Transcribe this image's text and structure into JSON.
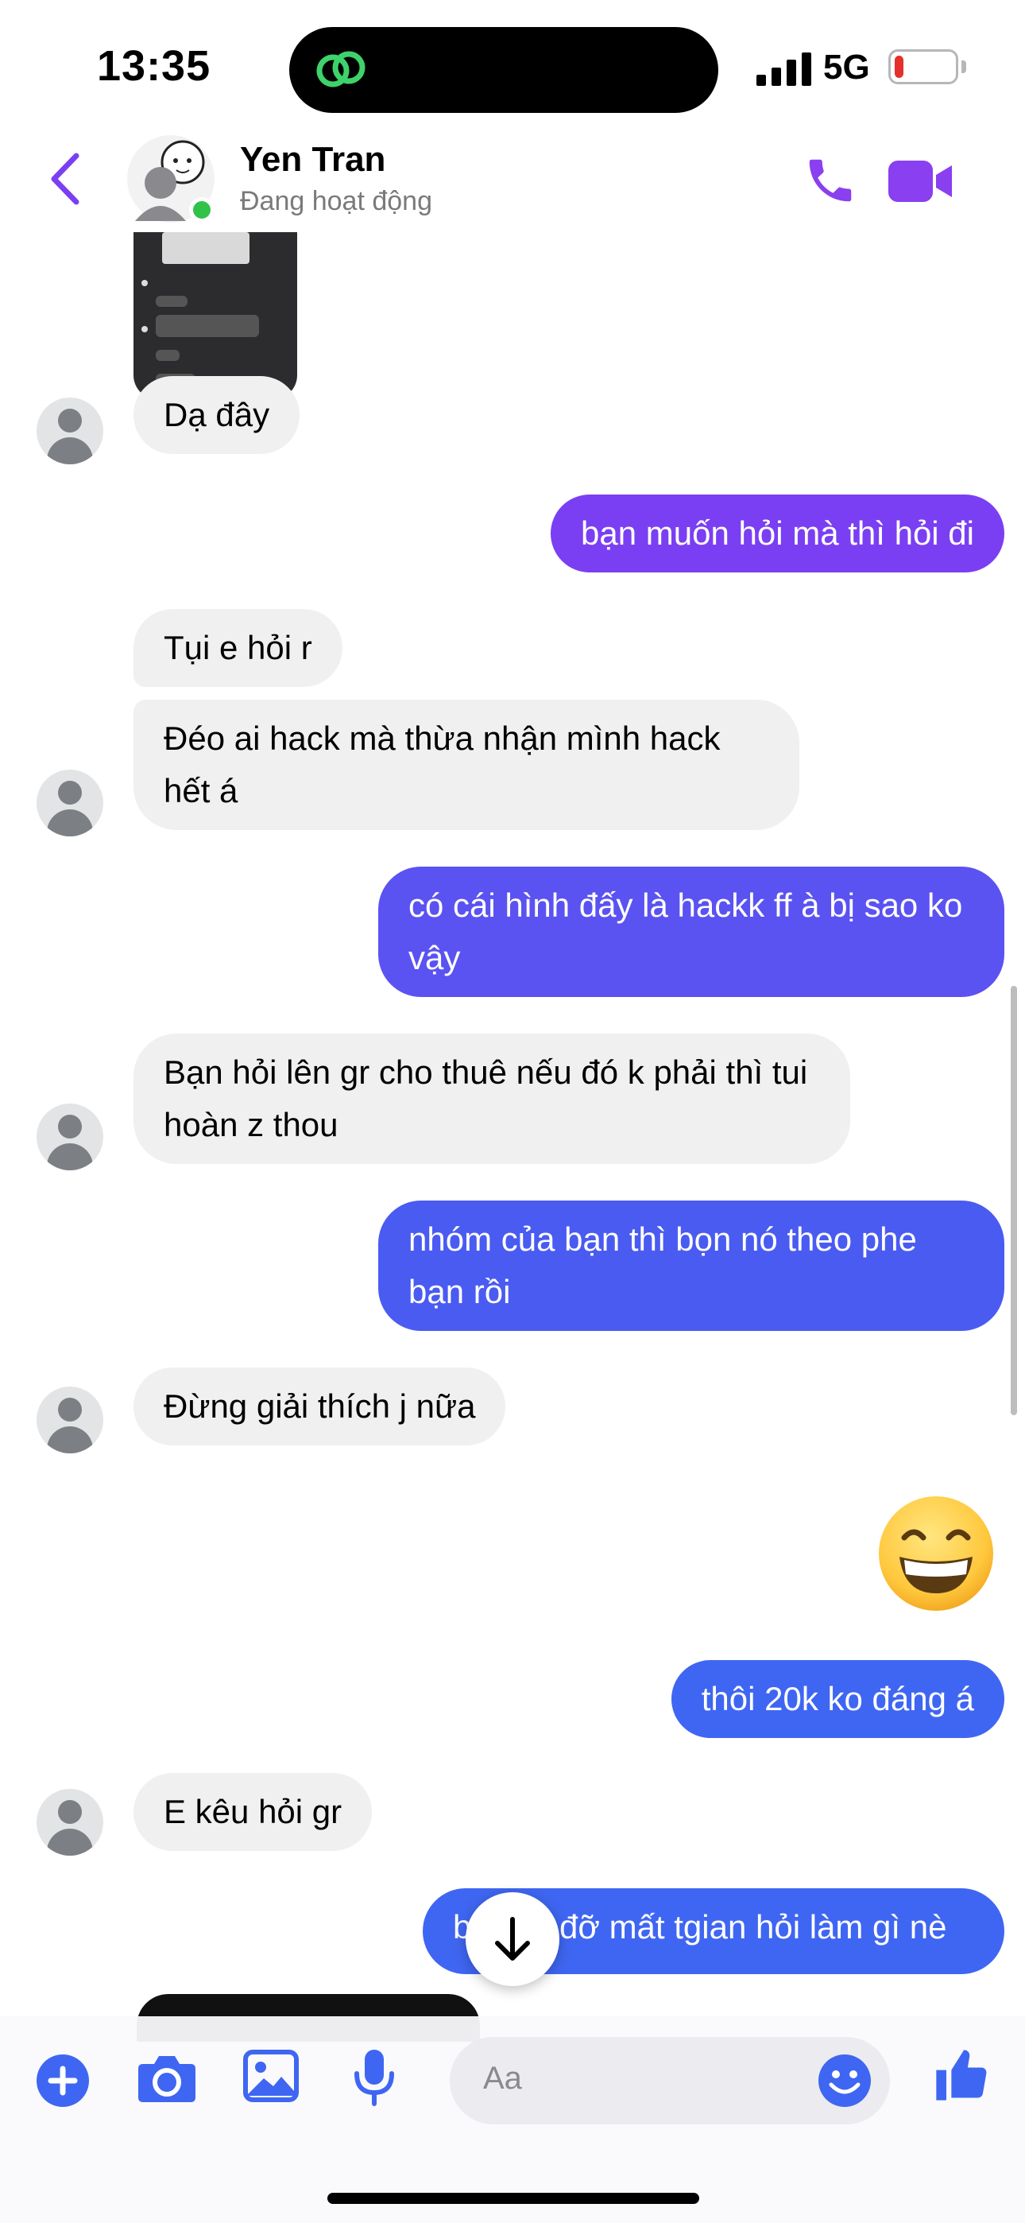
{
  "status_bar": {
    "time": "13:35",
    "network": "5G",
    "battery_level": 0.15
  },
  "header": {
    "contact_name": "Yen Tran",
    "presence": "Đang hoạt động"
  },
  "colors": {
    "accent": "#7b3ff2",
    "outgoing_top": "#7a3ff3",
    "outgoing_bottom": "#3f66f2",
    "incoming": "#f0f0f0",
    "online": "#31c24a"
  },
  "messages": [
    {
      "dir": "in",
      "text": "Dạ đây"
    },
    {
      "dir": "out",
      "text": "bạn muốn hỏi mà thì hỏi đi"
    },
    {
      "dir": "in",
      "text": "Tụi e hỏi r"
    },
    {
      "dir": "in",
      "text": "Đéo ai hack mà thừa nhận mình hack hết á"
    },
    {
      "dir": "out",
      "text": "có cái hình đấy là hackk ff à bị sao ko vậy"
    },
    {
      "dir": "in",
      "text": "Bạn hỏi lên gr cho thuê nếu đó k phải thì tui hoàn z thou"
    },
    {
      "dir": "out",
      "text": "nhóm của bạn thì bọn nó theo phe bạn rồi"
    },
    {
      "dir": "in",
      "text": "Đừng giải thích j nữa"
    },
    {
      "dir": "out",
      "text": "😁"
    },
    {
      "dir": "out",
      "text": "thôi 20k ko đáng á"
    },
    {
      "dir": "in",
      "text": "E kêu hỏi gr"
    },
    {
      "dir": "out",
      "text_left": "b",
      "text_right": "đỡ mất tgian hỏi làm gì nè"
    }
  ],
  "composer": {
    "placeholder": "Aa"
  }
}
